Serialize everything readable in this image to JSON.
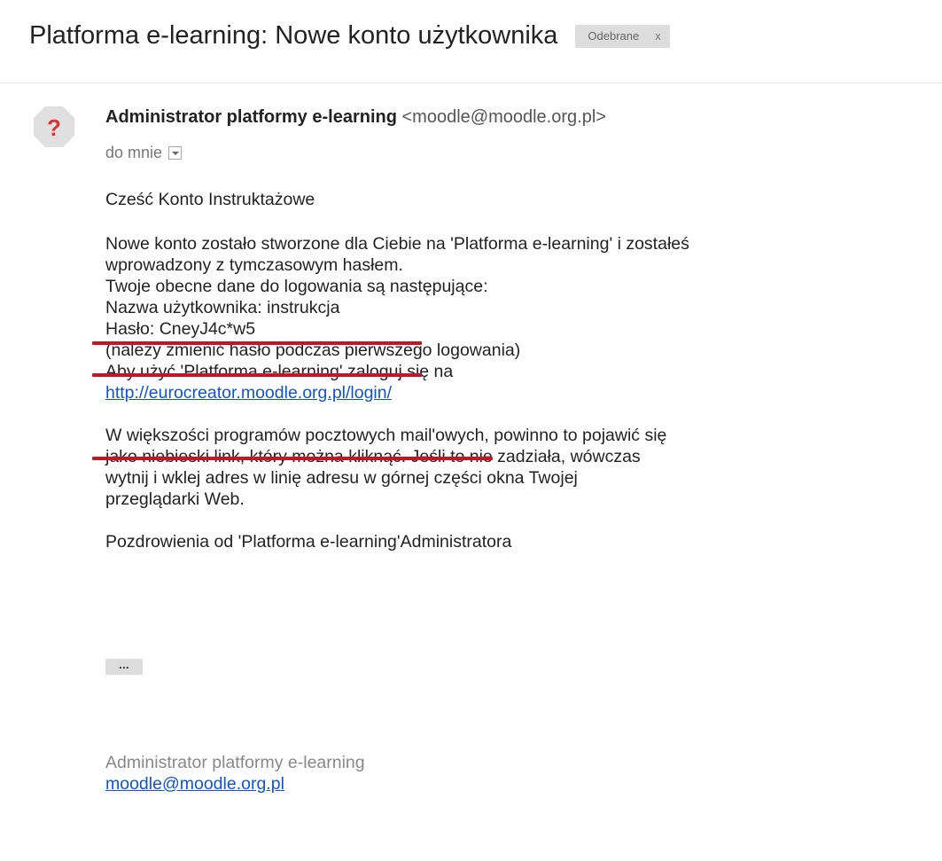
{
  "email": {
    "subject": "Platforma e-learning: Nowe konto użytkownika",
    "label": {
      "text": "Odebrane",
      "remove": "x"
    },
    "sender": {
      "avatar_icon": "?",
      "name": "Administrator platformy e-learning",
      "email": "<moodle@moodle.org.pl>"
    },
    "recipient": "do mnie",
    "body": {
      "greeting": "Cześć Konto Instruktażowe",
      "paragraph1": [
        "Nowe konto zostało stworzone dla Ciebie na 'Platforma e-learning' i zostałeś",
        "wprowadzony z tymczasowym hasłem.",
        "Twoje obecne dane do logowania są następujące:",
        "Nazwa użytkownika: instrukcja",
        "Hasło: CneyJ4c*w5",
        "(należy zmienić hasło podczas pierwszego logowania)",
        "Aby użyć 'Platforma e-learning' zaloguj się na"
      ],
      "login_link": "http://eurocreator.moodle.org.pl/login/",
      "paragraph2": [
        "W większości programów pocztowych mail'owych, powinno to pojawić się",
        "jako niebieski link, który można kliknąć. Jeśli to nie zadziała, wówczas",
        "wytnij i wklej adres w linię adresu w górnej części okna Twojej",
        "przeglądarki Web."
      ],
      "closing": "Pozdrowienia od 'Platforma e-learning'Administratora",
      "trimmed_content_button": "..."
    },
    "signature": {
      "name": "Administrator platformy e-learning",
      "email": "moodle@moodle.org.pl"
    }
  },
  "colors": {
    "link": "#1155cc",
    "highlight_underline": "#cc1122",
    "chip_background": "#dddddd"
  }
}
